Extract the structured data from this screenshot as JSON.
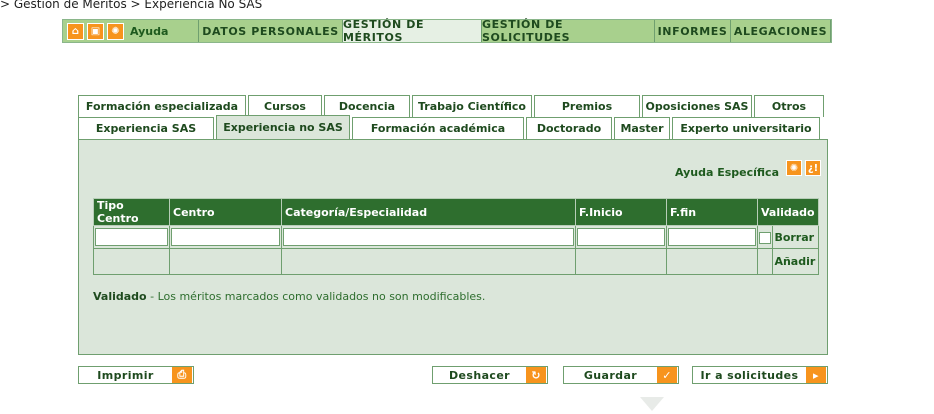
{
  "breadcrumb": "> Gestión de Méritos > Experiencia No SAS",
  "topnav": {
    "icons": [
      "home-icon",
      "lock-icon",
      "lightbulb-icon"
    ],
    "help_label": "Ayuda",
    "items": [
      "DATOS PERSONALES",
      "GESTIÓN DE MÉRITOS",
      "GESTIÓN DE SOLICITUDES",
      "INFORMES",
      "ALEGACIONES"
    ],
    "active": "GESTIÓN DE MÉRITOS"
  },
  "tabs": {
    "row1": [
      "Formación especializada",
      "Cursos",
      "Docencia",
      "Trabajo Científico",
      "Premios",
      "Oposiciones SAS",
      "Otros"
    ],
    "row2": [
      "Experiencia SAS",
      "Experiencia no SAS",
      "Formación académica",
      "Doctorado",
      "Master",
      "Experto universitario"
    ],
    "active": "Experiencia no SAS"
  },
  "panel": {
    "help_label": "Ayuda Específica",
    "table": {
      "headers": [
        "Tipo Centro",
        "Centro",
        "Categoría/Especialidad",
        "F.Inicio",
        "F.fin",
        "Validado"
      ],
      "row": {
        "tipo_centro": "",
        "centro": "",
        "categoria": "",
        "f_inicio": "",
        "f_fin": "",
        "validado": false
      },
      "delete_label": "Borrar",
      "add_label": "Añadir"
    },
    "note_bold": "Validado",
    "note_text": " - Los méritos marcados como validados no son modificables."
  },
  "buttons": {
    "print": "Imprimir",
    "undo": "Deshacer",
    "save": "Guardar",
    "go_requests": "Ir a solicitudes"
  },
  "colors": {
    "accent": "#f7941d",
    "header_green": "#2e6e2e",
    "nav_green": "#a8d08d",
    "panel_bg": "#dbe6da"
  }
}
